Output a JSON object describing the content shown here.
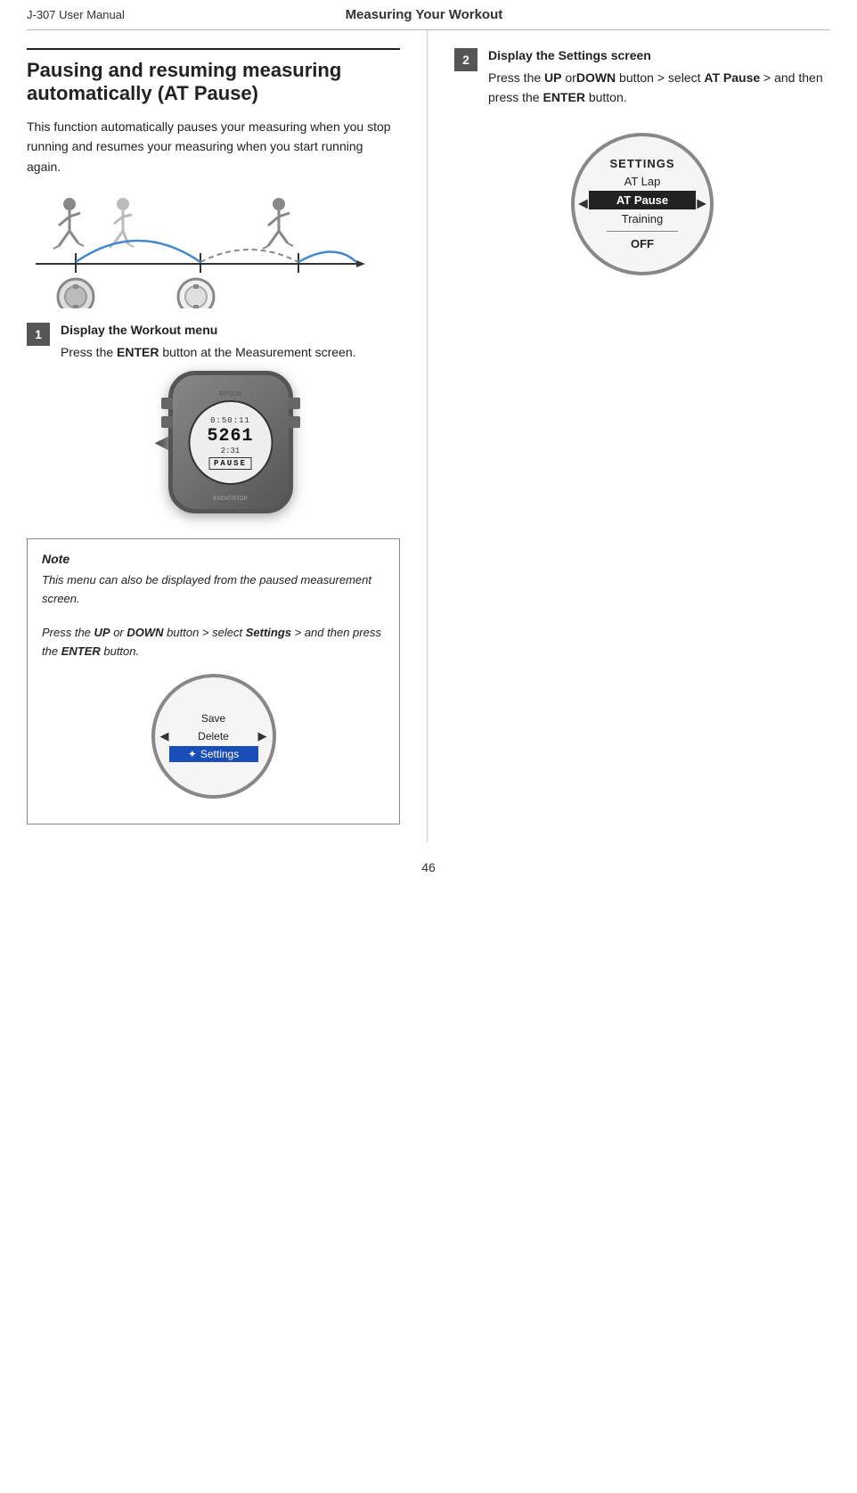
{
  "header": {
    "left": "J-307    User Manual",
    "center": "Measuring Your Workout"
  },
  "section": {
    "title": "Pausing and resuming measuring automatically (AT Pause)",
    "description": "This function automatically pauses your measuring when you stop running and resumes your measuring when you start running again."
  },
  "step1": {
    "number": "1",
    "title": "Display the Workout menu",
    "description_parts": [
      "Press the ",
      "ENTER",
      " button at the Measurement screen."
    ],
    "watch_display": {
      "brand": "EPSON",
      "time": "0:50:11",
      "big_number": "5261",
      "sub_number": "2:31",
      "pause_label": "PAUSE"
    }
  },
  "step2": {
    "number": "2",
    "title": "Display the Settings screen",
    "description_parts_1": [
      "Press the ",
      "UP",
      " or",
      "DOWN",
      " button > select ",
      "AT Pause",
      " > and then press the ",
      "ENTER",
      " button."
    ],
    "menu": {
      "header": "SETTINGS",
      "items": [
        "AT Lap",
        "AT Pause",
        "Training"
      ],
      "selected": "AT Pause",
      "bottom": "OFF"
    }
  },
  "note": {
    "title": "Note",
    "line1": "This menu can also be displayed from the paused measurement screen.",
    "line2_parts": [
      "Press the ",
      "UP",
      " or ",
      "DOWN",
      " button > select ",
      "Settings",
      " > and then press the ",
      "ENTER",
      " button."
    ],
    "menu": {
      "items": [
        "Save",
        "Delete",
        "Settings"
      ],
      "selected": "Settings",
      "selected_icon": "✦"
    }
  },
  "page_number": "46"
}
